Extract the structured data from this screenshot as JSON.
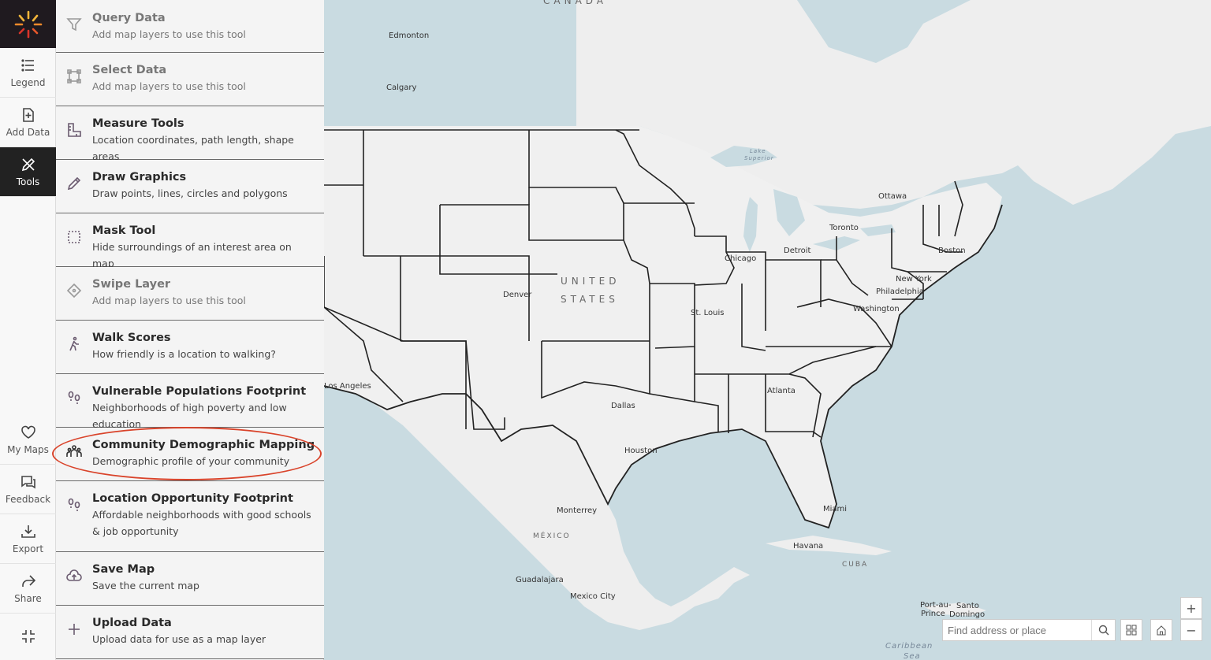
{
  "rail": {
    "legend": "Legend",
    "add_data": "Add Data",
    "tools": "Tools",
    "my_maps": "My Maps",
    "feedback": "Feedback",
    "export": "Export",
    "share": "Share"
  },
  "tools": [
    {
      "title": "Query Data",
      "desc": "Add map layers to use this tool",
      "icon": "filter-icon",
      "disabled": true
    },
    {
      "title": "Select Data",
      "desc": "Add map layers to use this tool",
      "icon": "select-box-icon",
      "disabled": true
    },
    {
      "title": "Measure Tools",
      "desc": "Location coordinates, path length, shape areas",
      "icon": "ruler-icon",
      "disabled": false
    },
    {
      "title": "Draw Graphics",
      "desc": "Draw points, lines, circles and polygons",
      "icon": "pencil-icon",
      "disabled": false
    },
    {
      "title": "Mask Tool",
      "desc": "Hide surroundings of an interest area on map",
      "icon": "mask-icon",
      "disabled": false
    },
    {
      "title": "Swipe Layer",
      "desc": "Add map layers to use this tool",
      "icon": "swipe-icon",
      "disabled": true
    },
    {
      "title": "Walk Scores",
      "desc": "How friendly is a location to walking?",
      "icon": "walk-icon",
      "disabled": false
    },
    {
      "title": "Vulnerable Populations Footprint",
      "desc": "Neighborhoods of high poverty and low education",
      "icon": "footprint-icon",
      "disabled": false
    },
    {
      "title": "Community Demographic Mapping",
      "desc": "Demographic profile of your community",
      "icon": "people-icon",
      "disabled": false
    },
    {
      "title": "Location Opportunity Footprint",
      "desc": "Affordable neighborhoods with good schools & job opportunity",
      "icon": "footprint-icon",
      "disabled": false
    },
    {
      "title": "Save Map",
      "desc": "Save the current map",
      "icon": "cloud-upload-icon",
      "disabled": false
    },
    {
      "title": "Upload Data",
      "desc": "Upload data for use as a map layer",
      "icon": "plus-icon",
      "disabled": false
    }
  ],
  "map": {
    "cities": [
      "Edmonton",
      "Calgary",
      "Ottawa",
      "Toronto",
      "Boston",
      "Detroit",
      "Chicago",
      "New York",
      "Philadelphia",
      "Washington",
      "Denver",
      "St. Louis",
      "Los Angeles",
      "Atlanta",
      "Dallas",
      "Houston",
      "Miami",
      "Monterrey",
      "Havana",
      "Guadalajara",
      "Mexico City",
      "Port-au-",
      "Prince",
      "Santo",
      "Domingo"
    ],
    "regions": [
      "CANADA",
      "UNITED",
      "STATES",
      "MÉXICO",
      "CUBA"
    ],
    "water": [
      "Lake",
      "Superior",
      "Caribbean",
      "Sea"
    ]
  },
  "search": {
    "placeholder": "Find address or place"
  },
  "zoom": {
    "in": "+",
    "out": "−"
  }
}
